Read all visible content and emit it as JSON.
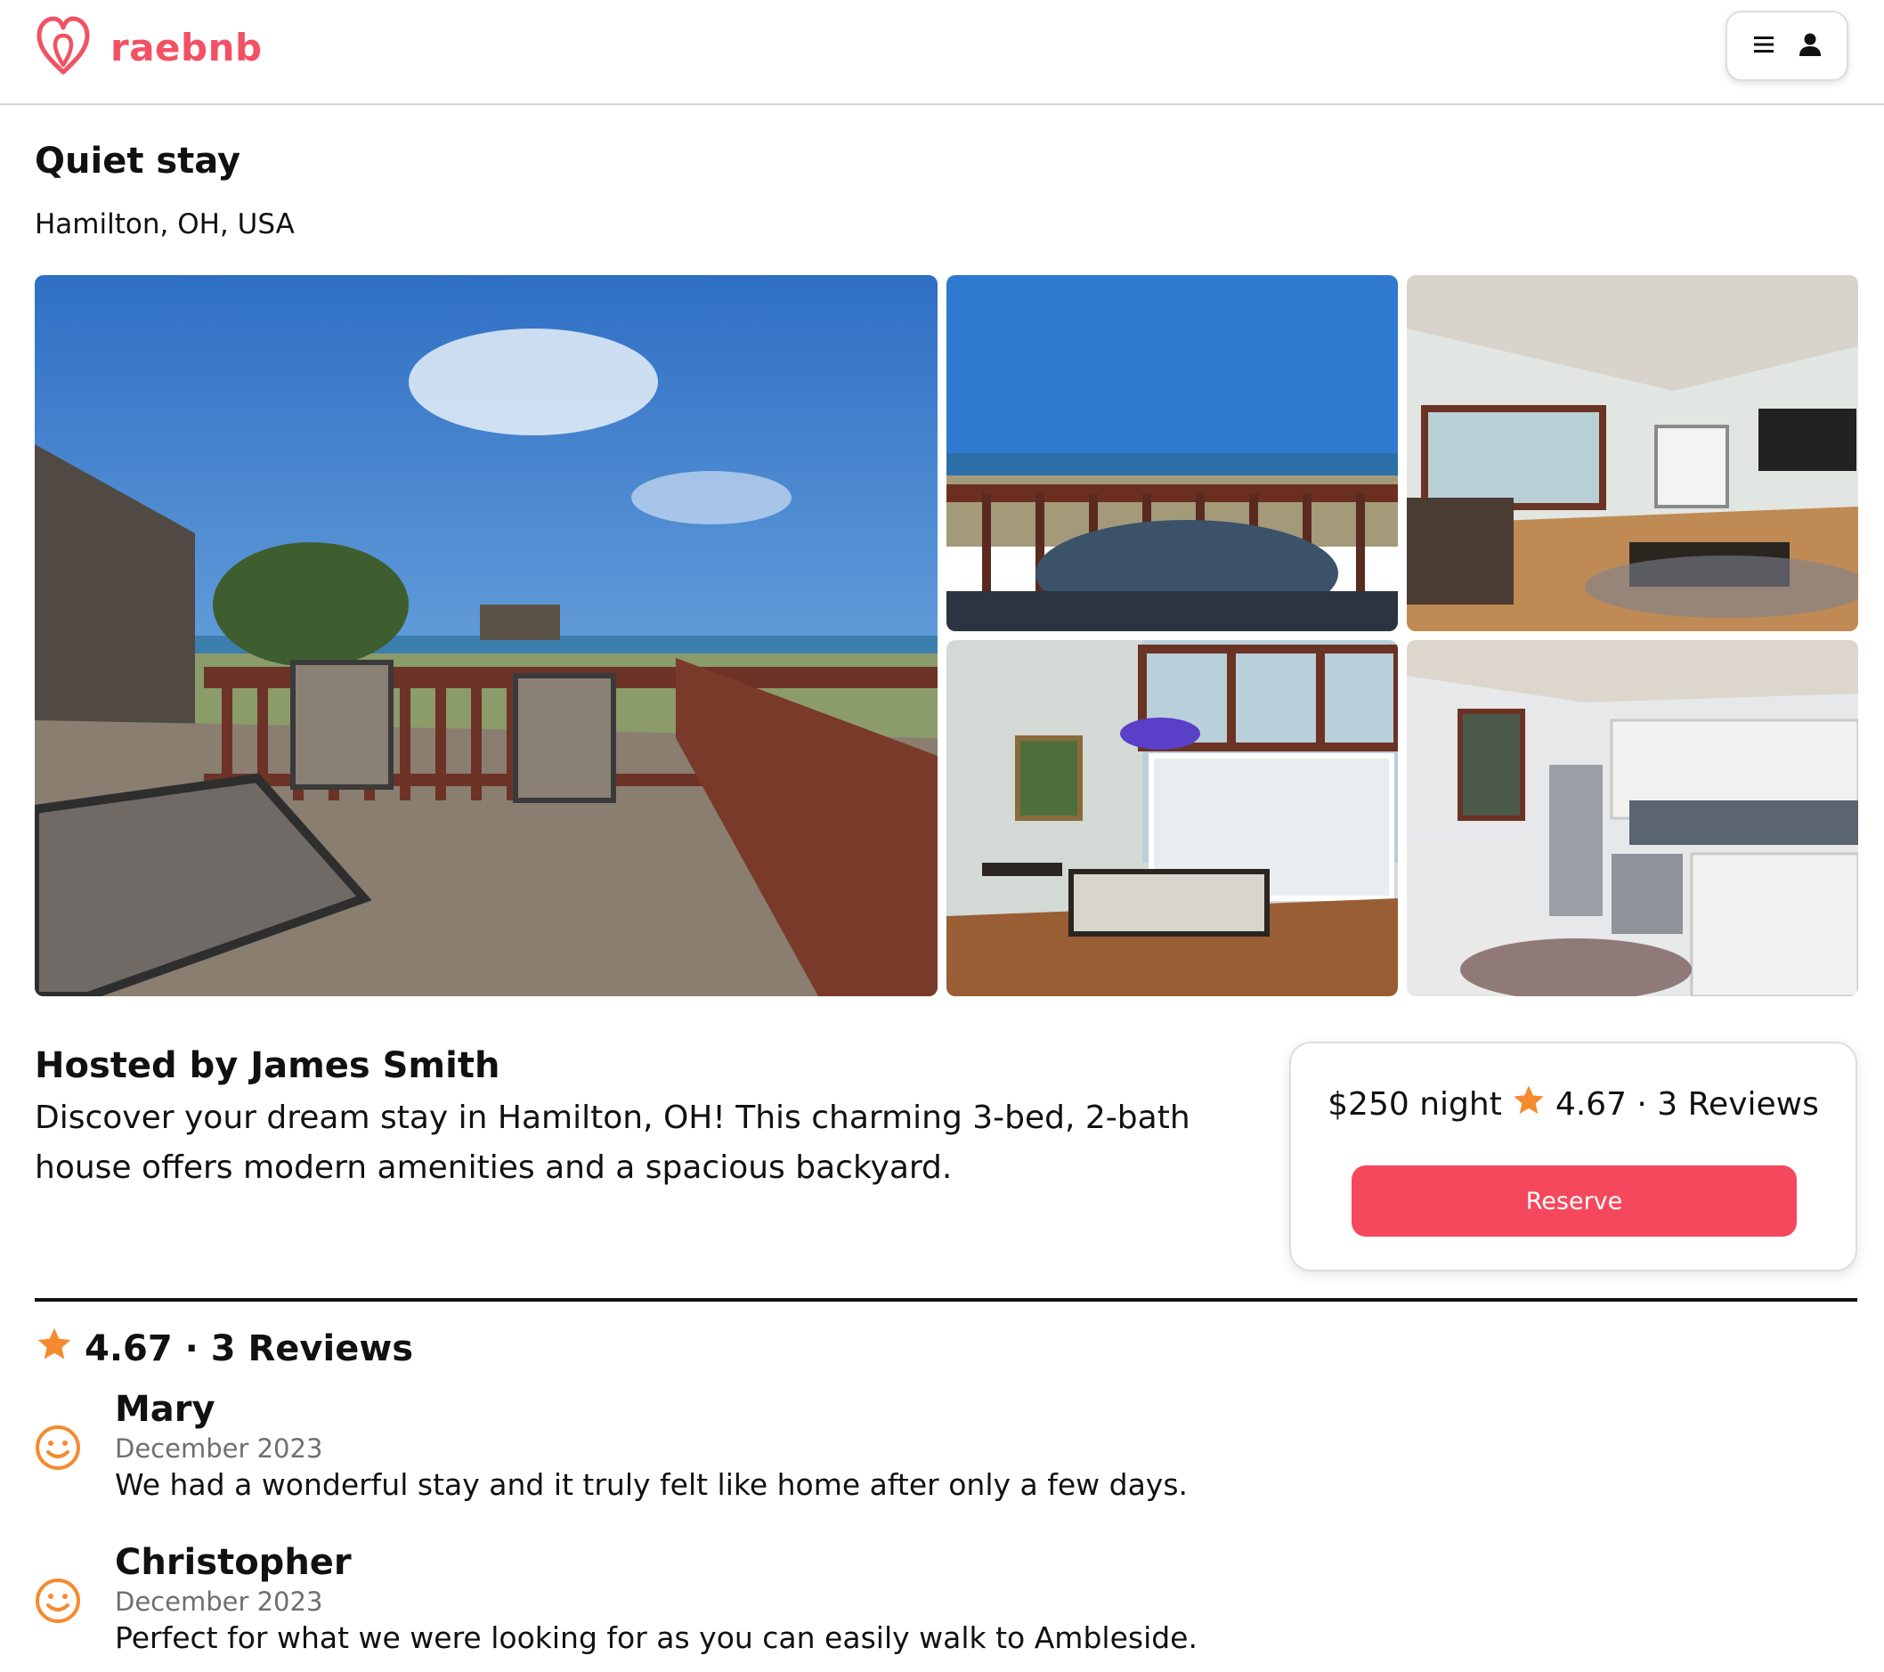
{
  "brand": {
    "name": "raebnb",
    "logo_icon": "raebnb-logo-icon",
    "color": "#f25164"
  },
  "header": {
    "menu_icon": "hamburger-icon",
    "profile_icon": "user-icon"
  },
  "listing": {
    "title": "Quiet stay",
    "location": "Hamilton, OH, USA"
  },
  "gallery": {
    "photos": [
      "deck-ocean-view",
      "patio-table-ocean",
      "living-room",
      "dining-room",
      "kitchen"
    ]
  },
  "host": {
    "title": "Hosted by James Smith",
    "description": "Discover your dream stay in Hamilton, OH! This charming 3-bed, 2-bath house offers modern amenities and a spacious backyard."
  },
  "booking": {
    "price": "$250 night",
    "rating_summary": "4.67 · 3 Reviews",
    "reserve_label": "Reserve",
    "accent_color": "#f5485c",
    "star_color": "#f58a2e"
  },
  "reviews": {
    "summary": "4.67 · 3 Reviews",
    "items": [
      {
        "name": "Mary",
        "date": "December 2023",
        "text": "We had a wonderful stay and it truly felt like home after only a few days."
      },
      {
        "name": "Christopher",
        "date": "December 2023",
        "text": "Perfect for what we were looking for as you can easily walk to Ambleside."
      }
    ]
  }
}
